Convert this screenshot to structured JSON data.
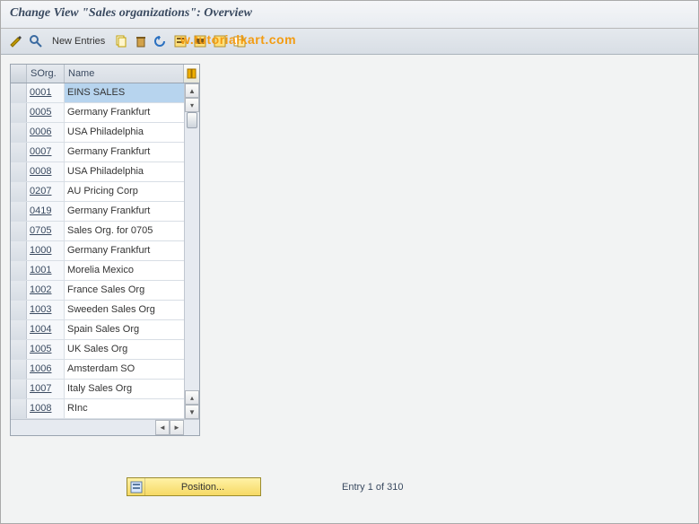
{
  "title": "Change View \"Sales organizations\": Overview",
  "toolbar": {
    "new_entries_label": "New Entries"
  },
  "watermark": "w.tutorialkart.com",
  "grid": {
    "columns": {
      "sorg": "SOrg.",
      "name": "Name"
    },
    "rows": [
      {
        "sorg": "0001",
        "name": "EINS SALES",
        "selected": true
      },
      {
        "sorg": "0005",
        "name": "Germany Frankfurt"
      },
      {
        "sorg": "0006",
        "name": "USA Philadelphia"
      },
      {
        "sorg": "0007",
        "name": "Germany Frankfurt"
      },
      {
        "sorg": "0008",
        "name": "USA Philadelphia"
      },
      {
        "sorg": "0207",
        "name": "AU Pricing Corp"
      },
      {
        "sorg": "0419",
        "name": "Germany Frankfurt"
      },
      {
        "sorg": "0705",
        "name": "Sales Org. for 0705"
      },
      {
        "sorg": "1000",
        "name": "Germany Frankfurt"
      },
      {
        "sorg": "1001",
        "name": "Morelia Mexico"
      },
      {
        "sorg": "1002",
        "name": "France Sales Org"
      },
      {
        "sorg": "1003",
        "name": "Sweeden Sales Org"
      },
      {
        "sorg": "1004",
        "name": "Spain Sales Org"
      },
      {
        "sorg": "1005",
        "name": "UK Sales Org"
      },
      {
        "sorg": "1006",
        "name": "Amsterdam SO"
      },
      {
        "sorg": "1007",
        "name": "Italy Sales Org"
      },
      {
        "sorg": "1008",
        "name": "RInc"
      }
    ]
  },
  "footer": {
    "position_label": "Position...",
    "entry_text": "Entry 1 of 310"
  }
}
